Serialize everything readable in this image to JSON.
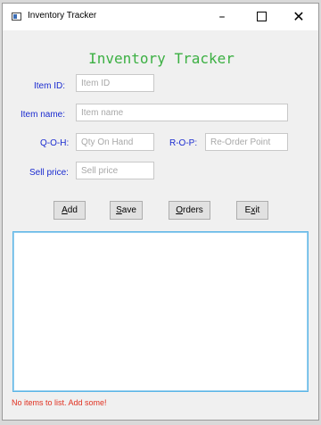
{
  "window": {
    "title": "Inventory Tracker",
    "controls": {
      "minimize": "–",
      "close": "✕"
    }
  },
  "app": {
    "heading": "Inventory Tracker",
    "heading_color": "#3cb043",
    "label_color": "#1a2bd0"
  },
  "form": {
    "item_id": {
      "label": "Item ID:",
      "placeholder": "Item ID",
      "value": ""
    },
    "item_name": {
      "label": "Item name:",
      "placeholder": "Item name",
      "value": ""
    },
    "qoh": {
      "label": "Q-O-H:",
      "placeholder": "Qty On Hand",
      "value": ""
    },
    "rop": {
      "label": "R-O-P:",
      "placeholder": "Re-Order Point",
      "value": ""
    },
    "sell_price": {
      "label": "Sell price:",
      "placeholder": "Sell price",
      "value": ""
    }
  },
  "buttons": {
    "add": {
      "mnemonic": "A",
      "rest": "dd"
    },
    "save": {
      "mnemonic": "S",
      "rest": "ave"
    },
    "orders": {
      "mnemonic": "O",
      "rest": "rders"
    },
    "exit": {
      "pre": "E",
      "mnemonic": "x",
      "rest": "it"
    }
  },
  "status": {
    "message": "No items to list. Add some!",
    "color": "#e03020"
  }
}
